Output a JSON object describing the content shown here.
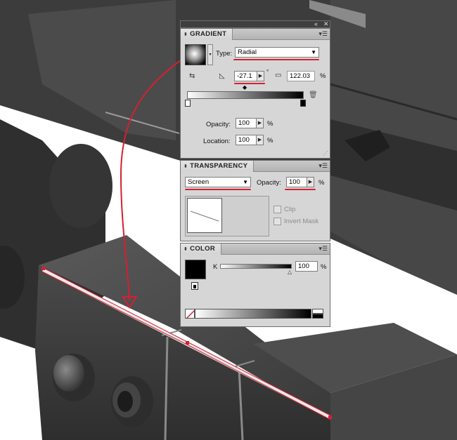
{
  "window": {
    "collapse_icon": "double-chevron-left-icon",
    "close_icon": "close-icon"
  },
  "gradient": {
    "title": "GRADIENT",
    "type_label": "Type:",
    "type_value": "Radial",
    "angle_value": "-27.1",
    "degree_symbol": "°",
    "aspect_value": "122.03",
    "aspect_unit": "%",
    "opacity_label": "Opacity:",
    "opacity_value": "100",
    "opacity_unit": "%",
    "location_label": "Location:",
    "location_value": "100",
    "location_unit": "%"
  },
  "transparency": {
    "title": "TRANSPARENCY",
    "blend_mode": "Screen",
    "opacity_label": "Opacity:",
    "opacity_value": "100",
    "opacity_unit": "%",
    "clip_label": "Clip",
    "invert_mask_label": "Invert Mask"
  },
  "color": {
    "title": "COLOR",
    "channel_label": "K",
    "channel_value": "100",
    "channel_unit": "%",
    "fill": "#000000"
  },
  "colors": {
    "annotation_red": "#d42032",
    "accent_gray": "#d6d6d6"
  }
}
